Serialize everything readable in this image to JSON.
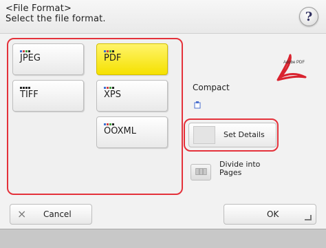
{
  "header": {
    "title": "<File Format>",
    "subtitle": "Select the file format.",
    "help_label": "?"
  },
  "formats": [
    {
      "label": "JPEG",
      "selected": false,
      "icon": "image-format-icon"
    },
    {
      "label": "PDF",
      "selected": true,
      "icon": "document-format-icon"
    },
    {
      "label": "TIFF",
      "selected": false,
      "icon": "image-format-icon"
    },
    {
      "label": "XPS",
      "selected": false,
      "icon": "document-format-icon"
    },
    {
      "label": "OOXML",
      "selected": false,
      "icon": "document-format-icon"
    }
  ],
  "adobe_logo_text": "Adobe PDF",
  "options": {
    "compact_label": "Compact",
    "set_details_label": "Set Details",
    "divide_label": "Divide into Pages"
  },
  "footer": {
    "cancel_icon": "×",
    "cancel_label": "Cancel",
    "ok_label": "OK"
  },
  "colors": {
    "highlight_outline": "#e4313a",
    "selected_bg": "#f5e100"
  }
}
